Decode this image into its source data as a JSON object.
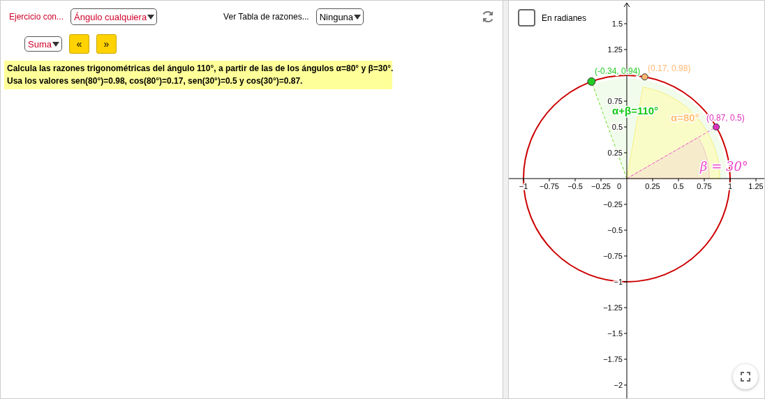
{
  "toolbar": {
    "exercise_label": "Ejercicio con...",
    "exercise_select": "Ángulo cualquiera",
    "table_label": "Ver Tabla de razones...",
    "table_select": "Ninguna",
    "operation_select": "Suma",
    "nav_buttons": [
      "«",
      "»"
    ]
  },
  "statement": [
    "Calcula las razones trigonométricas del ángulo 110°, a partir de las de los ángulos α=80° y β=30°.",
    "Usa los valores  sen(80°)=0.98, cos(80°)=0.17, sen(30°)=0.5 y cos(30°)=0.87."
  ],
  "graph": {
    "radians_checkbox": {
      "label": "En radianes",
      "checked": false
    },
    "x_ticks": [
      "−1",
      "−0.75",
      "−0.5",
      "−0.25",
      "0",
      "0.25",
      "0.5",
      "0.75",
      "1",
      "1.25"
    ],
    "y_ticks": [
      "1.5",
      "1.25",
      "0.75",
      "0.5",
      "0.25",
      "−0.25",
      "−0.5",
      "−0.75",
      "−1",
      "−1.25",
      "−1.5",
      "−1.75",
      "−2"
    ],
    "points": [
      {
        "label": "(-0.34, 0.94)",
        "color": "#22cc22"
      },
      {
        "label": "(0.17, 0.98)",
        "color": "#ffb870"
      },
      {
        "label": "(0.87, 0.5)",
        "color": "#e030c0"
      }
    ],
    "angle_labels": [
      "α+β=110°",
      "α=80°",
      "β = 30°"
    ]
  }
}
